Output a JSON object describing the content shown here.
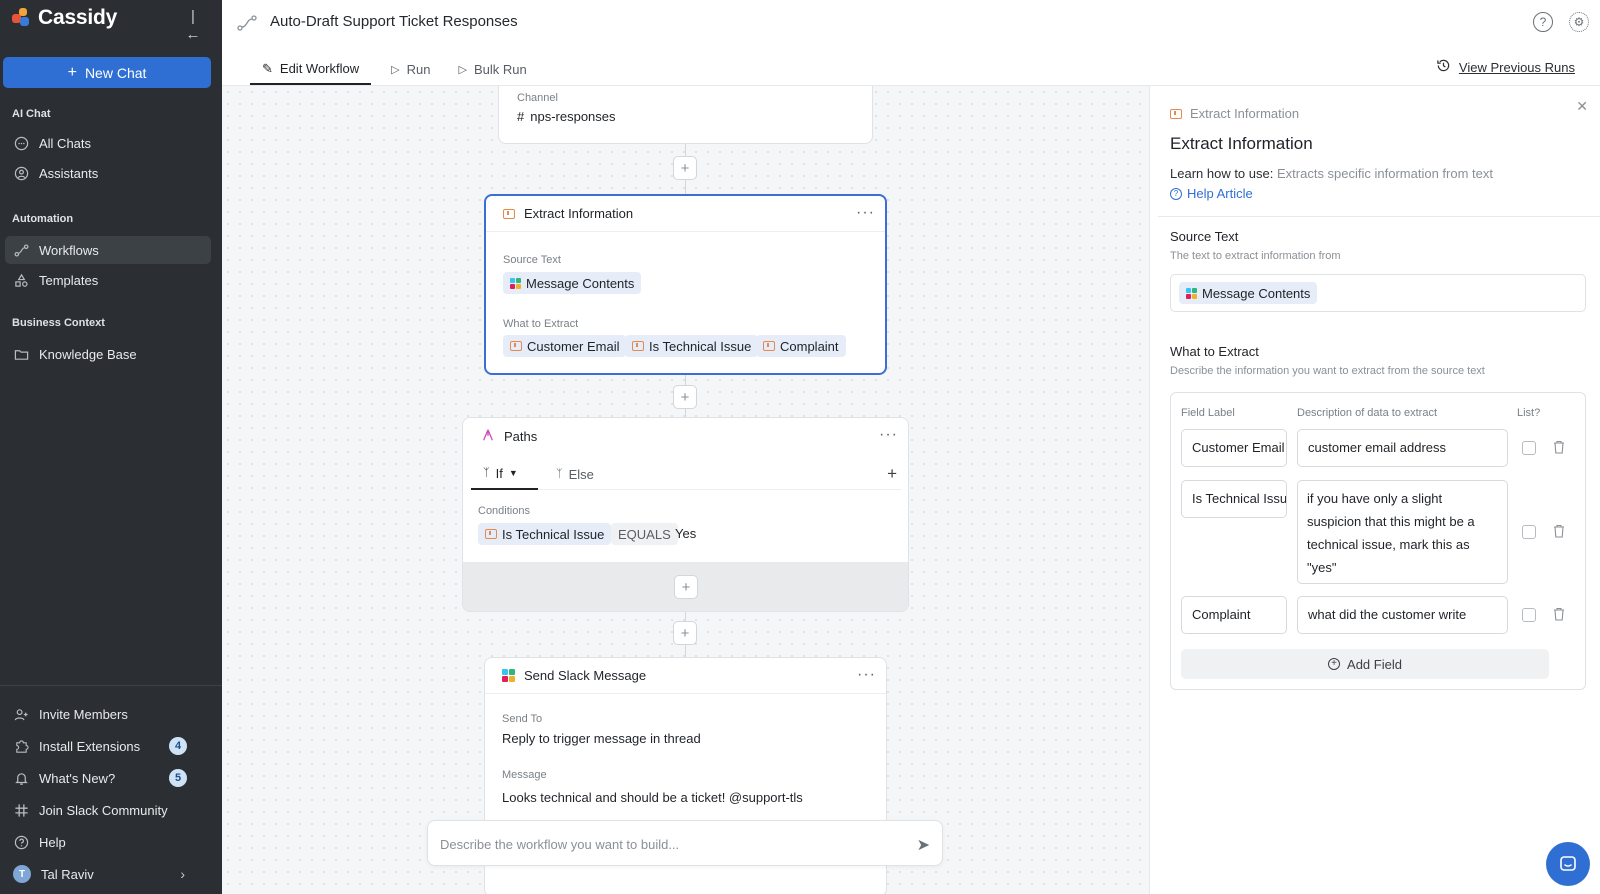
{
  "sidebar": {
    "brand": "Cassidy",
    "new_chat": "New Chat",
    "sections": {
      "ai_chat": "AI Chat",
      "automation": "Automation",
      "business_context": "Business Context"
    },
    "items": {
      "all_chats": "All Chats",
      "assistants": "Assistants",
      "workflows": "Workflows",
      "templates": "Templates",
      "knowledge_base": "Knowledge Base"
    },
    "footer": {
      "invite": "Invite Members",
      "extensions": "Install Extensions",
      "extensions_badge": "4",
      "whats_new": "What's New?",
      "whats_new_badge": "5",
      "slack": "Join Slack Community",
      "help": "Help",
      "user": "Tal Raviv",
      "user_initial": "T"
    }
  },
  "header": {
    "title": "Auto-Draft Support Ticket Responses",
    "tabs": [
      "Edit Workflow",
      "Run",
      "Bulk Run"
    ],
    "view_previous": "View Previous Runs"
  },
  "canvas": {
    "trigger": {
      "channel_label": "Channel",
      "channel_value": "nps-responses"
    },
    "extract": {
      "title": "Extract Information",
      "source_label": "Source Text",
      "source_chip": "Message Contents",
      "what_label": "What to Extract",
      "chips": [
        "Customer Email",
        "Is Technical Issue",
        "Complaint"
      ]
    },
    "paths": {
      "title": "Paths",
      "tab_if": "If",
      "tab_else": "Else",
      "conditions_label": "Conditions",
      "cond_field": "Is Technical Issue",
      "cond_op": "EQUALS",
      "cond_value": "Yes"
    },
    "slack": {
      "title": "Send Slack Message",
      "send_to_label": "Send To",
      "send_to_value": "Reply to trigger message in thread",
      "message_label": "Message",
      "message_value": "Looks technical and should be a ticket! @support-tls"
    },
    "chat_placeholder": "Describe the workflow you want to build..."
  },
  "panel": {
    "crumb": "Extract Information",
    "title": "Extract Information",
    "learn_prefix": "Learn how to use:",
    "learn_desc": "Extracts specific information from text",
    "help_article": "Help Article",
    "source_label": "Source Text",
    "source_sub": "The text to extract information from",
    "source_chip": "Message Contents",
    "what_label": "What to Extract",
    "what_sub": "Describe the information you want to extract from the source text",
    "col_label": "Field Label",
    "col_desc": "Description of data to extract",
    "col_list": "List?",
    "fields": [
      {
        "label": "Customer Email",
        "desc": "customer email address"
      },
      {
        "label": "Is Technical Issue",
        "desc": "if you have only a slight suspicion that this might be a technical issue, mark this as \"yes\""
      },
      {
        "label": "Complaint",
        "desc": "what did the customer write"
      }
    ],
    "add_field": "Add Field"
  },
  "colors": {
    "sidebar_bg": "#2b2f33",
    "accent": "#2f6fd4",
    "selected_border": "#3b6fd6",
    "chip_bg": "#e7edf8"
  }
}
